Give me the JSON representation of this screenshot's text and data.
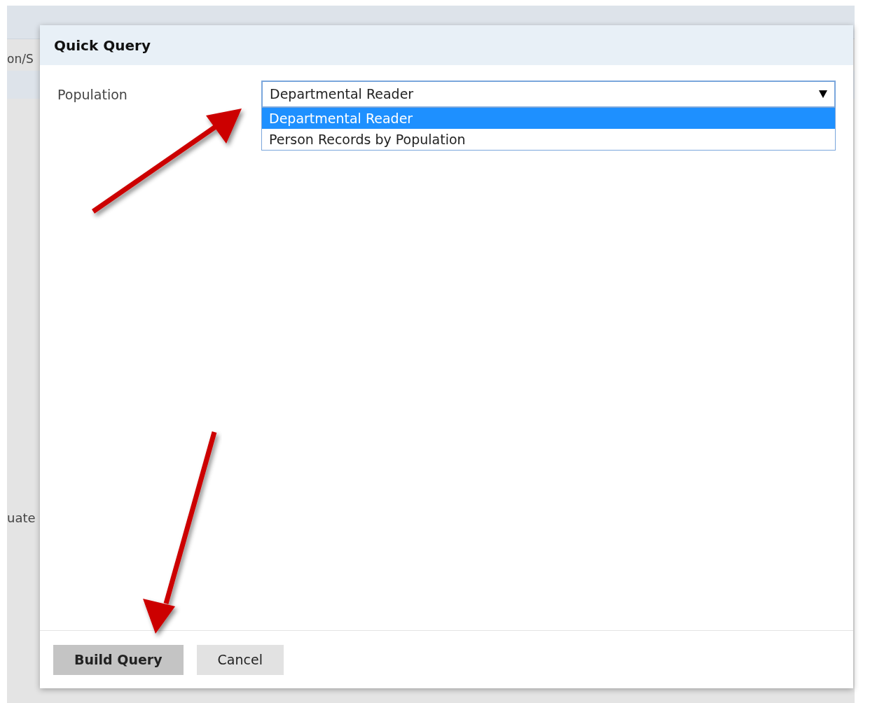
{
  "background": {
    "fragments": [
      {
        "text": "on/S"
      },
      {
        "text": "uate"
      }
    ]
  },
  "dialog": {
    "title": "Quick Query",
    "field": {
      "label": "Population",
      "value": "Departmental Reader",
      "expanded": true,
      "options": [
        {
          "label": "Departmental Reader",
          "selected": true
        },
        {
          "label": "Person Records by Population",
          "selected": false
        }
      ]
    },
    "buttons": [
      {
        "label": "Build Query",
        "kind": "primary"
      },
      {
        "label": "Cancel",
        "kind": "secondary"
      }
    ]
  }
}
